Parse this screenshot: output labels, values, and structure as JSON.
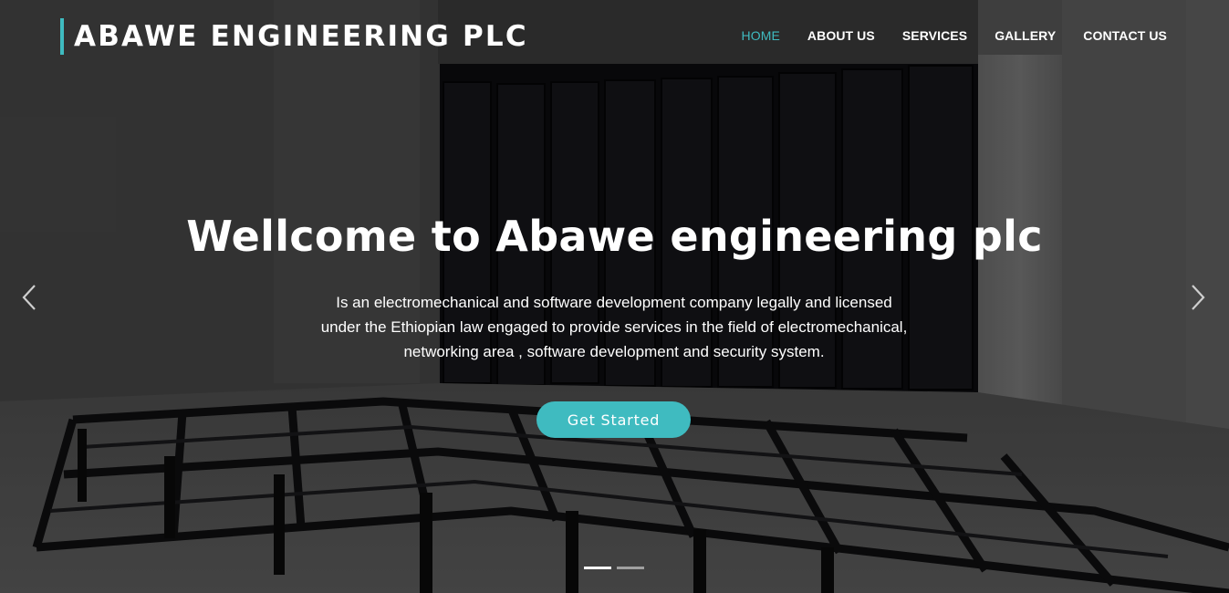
{
  "brand": {
    "name": "ABAWE ENGINEERING PLC",
    "accent_color": "#3fbbc0"
  },
  "nav": {
    "items": [
      {
        "label": "HOME",
        "active": true
      },
      {
        "label": "ABOUT US",
        "active": false
      },
      {
        "label": "SERVICES",
        "active": false
      },
      {
        "label": "GALLERY",
        "active": false
      },
      {
        "label": "CONTACT US",
        "active": false
      }
    ]
  },
  "hero": {
    "title": "Wellcome to Abawe engineering plc",
    "description": "Is an electromechanical and software development company legally and licensed under the Ethiopian law engaged to provide services in the field of electromechanical, networking area , software development and security system.",
    "cta_label": "Get Started",
    "background_icon": "server-room-photo"
  },
  "carousel": {
    "prev_icon": "chevron-left-icon",
    "next_icon": "chevron-right-icon",
    "slide_count": 2,
    "active_slide": 1
  }
}
